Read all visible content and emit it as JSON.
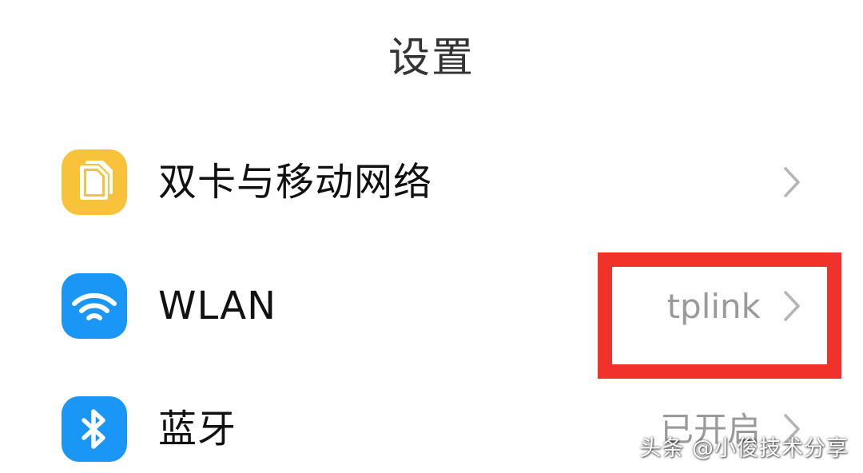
{
  "header": {
    "title": "设置"
  },
  "settings": {
    "items": [
      {
        "label": "双卡与移动网络",
        "value": "",
        "icon": "sim-card-icon",
        "icon_color": "#f8c23a"
      },
      {
        "label": "WLAN",
        "value": "tplink",
        "icon": "wifi-icon",
        "icon_color": "#1a96f6"
      },
      {
        "label": "蓝牙",
        "value": "已开启",
        "icon": "bluetooth-icon",
        "icon_color": "#1a96f6"
      }
    ]
  },
  "annotation": {
    "highlight_color": "#f0322a"
  },
  "watermark": {
    "text": "头条 @小俊技术分享"
  }
}
